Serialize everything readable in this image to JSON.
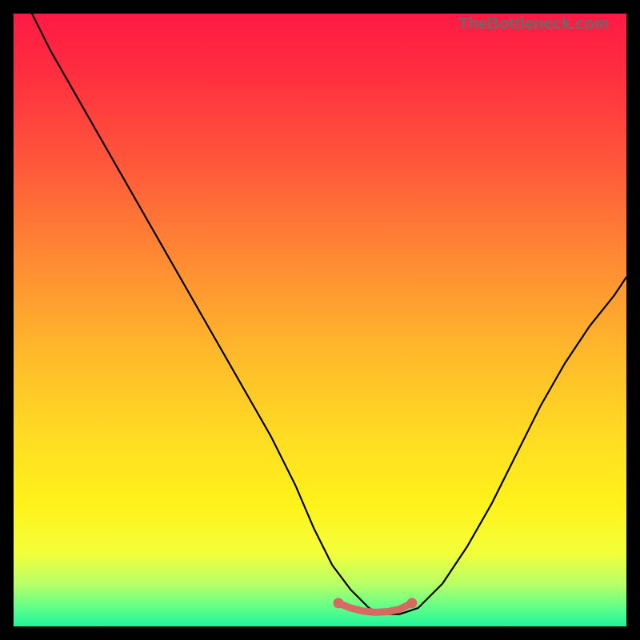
{
  "watermark": "TheBottleneck.com",
  "colors": {
    "frame": "#000000",
    "curve": "#000000",
    "marker": "#d66a63",
    "gradient_stops": [
      {
        "offset": 0.0,
        "color": "#ff1a44"
      },
      {
        "offset": 0.1,
        "color": "#ff2f3f"
      },
      {
        "offset": 0.25,
        "color": "#ff593a"
      },
      {
        "offset": 0.4,
        "color": "#ff8a33"
      },
      {
        "offset": 0.55,
        "color": "#ffb82b"
      },
      {
        "offset": 0.7,
        "color": "#ffde22"
      },
      {
        "offset": 0.8,
        "color": "#fff21a"
      },
      {
        "offset": 0.88,
        "color": "#f3ff3a"
      },
      {
        "offset": 0.93,
        "color": "#b9ff66"
      },
      {
        "offset": 0.97,
        "color": "#5fff8a"
      },
      {
        "offset": 1.0,
        "color": "#1df59a"
      }
    ]
  },
  "chart_data": {
    "type": "line",
    "title": "",
    "xlabel": "",
    "ylabel": "",
    "xlim": [
      0,
      100
    ],
    "ylim": [
      0,
      100
    ],
    "grid": false,
    "legend": false,
    "series": [
      {
        "name": "bottleneck-curve",
        "x": [
          3,
          6,
          10,
          14,
          18,
          22,
          26,
          30,
          34,
          38,
          42,
          46,
          49,
          52,
          55,
          58,
          60,
          63,
          66,
          70,
          74,
          78,
          82,
          86,
          90,
          94,
          98,
          100
        ],
        "y": [
          100,
          94,
          87,
          80,
          73,
          66,
          59,
          52,
          45,
          38,
          31,
          23,
          16,
          10,
          6,
          3,
          2,
          2,
          3,
          7,
          13,
          20,
          28,
          36,
          43,
          49,
          54,
          57
        ]
      }
    ],
    "markers": {
      "name": "flat-bottom-markers",
      "x": [
        53,
        55,
        57,
        59,
        61,
        63,
        65
      ],
      "y": [
        3.8,
        3.0,
        2.5,
        2.3,
        2.4,
        2.8,
        3.8
      ]
    },
    "annotations": []
  }
}
